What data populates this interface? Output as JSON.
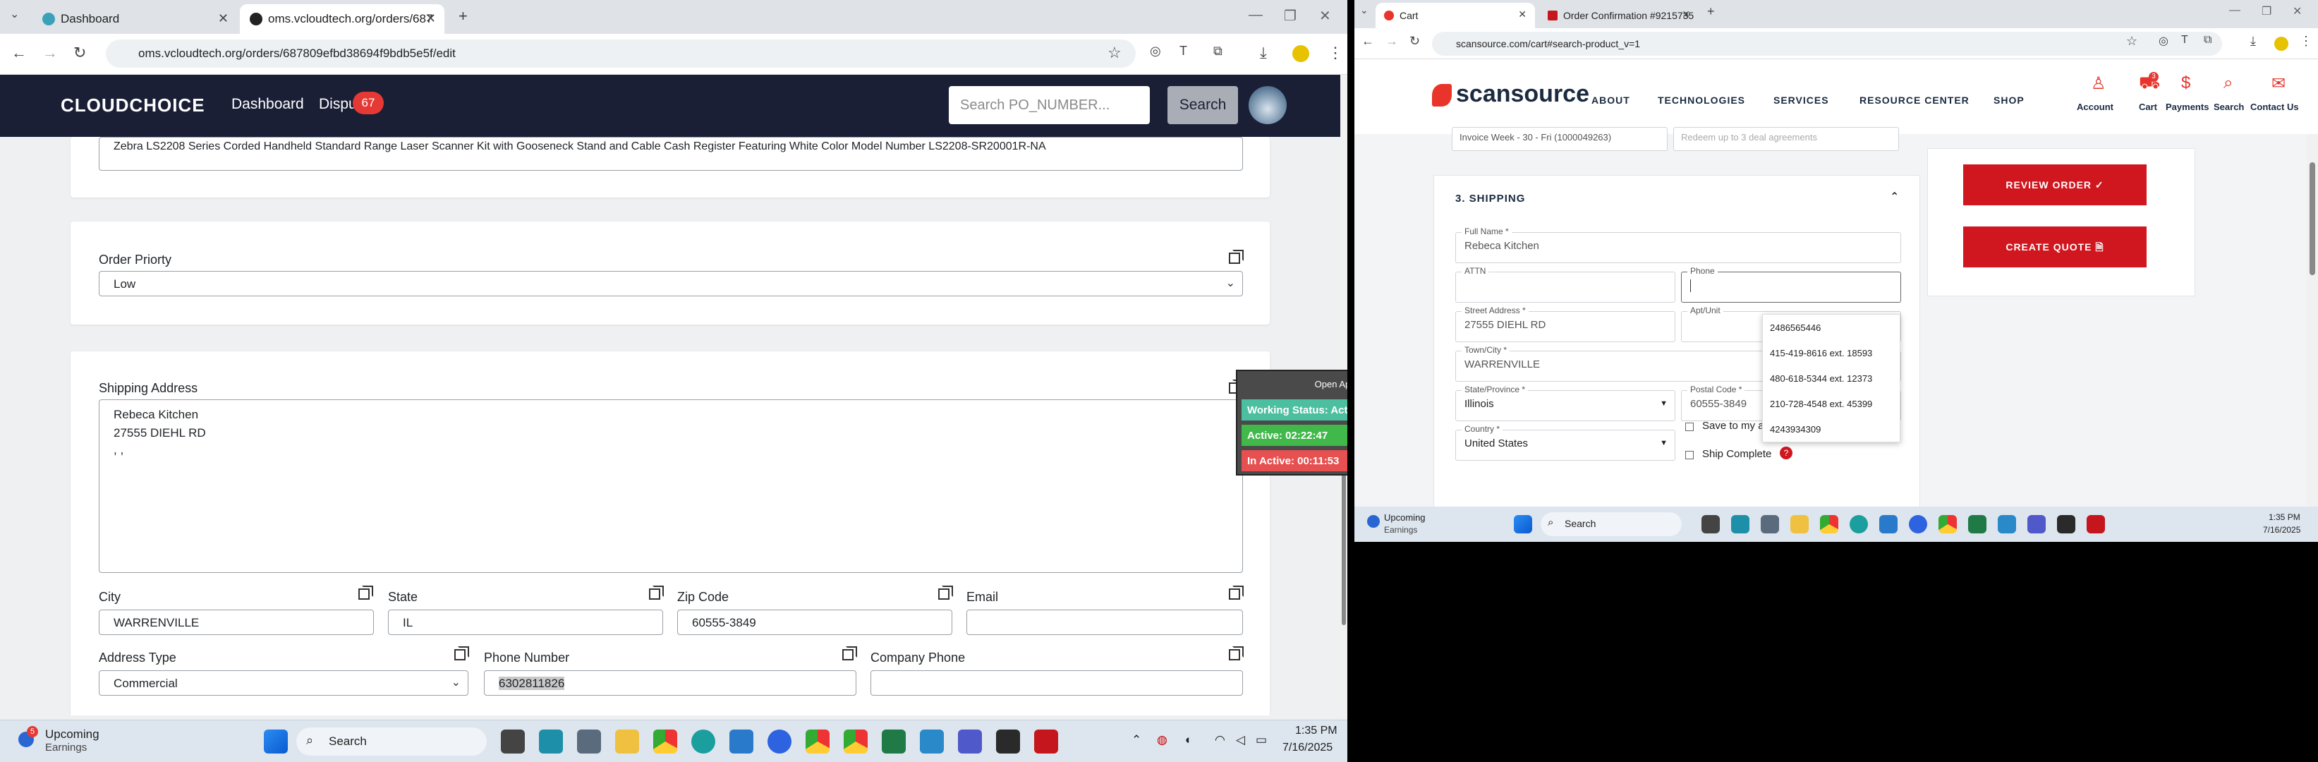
{
  "left_browser": {
    "tabs": [
      {
        "title": "Dashboard",
        "active": false
      },
      {
        "title": "oms.vcloudtech.org/orders/687",
        "active": true
      }
    ],
    "url": "oms.vcloudtech.org/orders/687809efbd38694f9bdb5e5f/edit",
    "app": {
      "logo": "CLOUDCHOICE",
      "nav": {
        "dashboard": "Dashboard",
        "disputes": "Dispu",
        "disputes_badge": "67"
      },
      "search_placeholder": "Search PO_NUMBER...",
      "search_button": "Search"
    },
    "form": {
      "product_description": "Zebra LS2208 Series Corded Handheld Standard Range Laser Scanner Kit with Gooseneck Stand and Cable Cash Register Featuring White Color Model Number LS2208-SR20001R-NA",
      "order_priority_label": "Order Priorty",
      "order_priority_value": "Low",
      "shipping_address_label": "Shipping Address",
      "shipping_address_lines": [
        "Rebeca Kitchen",
        "27555 DIEHL RD",
        ", ,"
      ],
      "city_label": "City",
      "city_value": "WARRENVILLE",
      "state_label": "State",
      "state_value": "IL",
      "zip_label": "Zip Code",
      "zip_value": "60555-3849",
      "email_label": "Email",
      "email_value": "",
      "address_type_label": "Address Type",
      "address_type_value": "Commercial",
      "phone_label": "Phone Number",
      "phone_value": "6302811826",
      "company_phone_label": "Company Phone",
      "company_phone_value": ""
    },
    "widget": {
      "open_app": "Open App ↗",
      "working_status": "Working Status: Active",
      "active": "Active: 02:22:47",
      "inactive": "In Active: 00:11:53"
    },
    "taskbar": {
      "weather_title": "Upcoming",
      "weather_sub": "Earnings",
      "weather_badge": "5",
      "search": "Search",
      "time": "1:35 PM",
      "date": "7/16/2025"
    }
  },
  "right_browser": {
    "tabs": [
      {
        "title": "Cart",
        "active": true
      },
      {
        "title": "Order Confirmation #9215735",
        "active": false
      }
    ],
    "url": "scansource.com/cart#search-product_v=1",
    "site": {
      "logo": "scansource",
      "menu": [
        "ABOUT",
        "TECHNOLOGIES",
        "SERVICES",
        "RESOURCE CENTER",
        "SHOP"
      ],
      "utils": [
        "Account",
        "Cart",
        "Payments",
        "Search",
        "Contact Us"
      ],
      "cart_count": "3"
    },
    "checkout": {
      "invoice_value": "Invoice Week - 30 - Fri (1000049263)",
      "deal_placeholder": "Redeem up to 3 deal agreements",
      "section_title": "3. SHIPPING",
      "full_name_label": "Full Name *",
      "full_name_value": "Rebeca Kitchen",
      "attn_label": "ATTN",
      "phone_label": "Phone",
      "street_label": "Street Address *",
      "street_value": "27555 DIEHL RD",
      "apt_label": "Apt/Unit",
      "town_label": "Town/City *",
      "town_value": "WARRENVILLE",
      "state_label": "State/Province *",
      "state_value": "Illinois",
      "postal_label": "Postal Code *",
      "postal_value": "60555-3849",
      "country_label": "Country *",
      "country_value": "United States",
      "save_address": "Save to my address book",
      "ship_complete": "Ship Complete",
      "phone_suggestions": [
        "2486565446",
        "415-419-8616 ext. 18593",
        "480-618-5344 ext. 12373",
        "210-728-4548 ext. 45399",
        "4243934309"
      ],
      "review_order": "REVIEW ORDER ✓",
      "create_quote": "CREATE QUOTE 🗎"
    },
    "taskbar": {
      "weather_title": "Upcoming",
      "weather_sub": "Earnings",
      "search": "Search",
      "time": "1:35 PM",
      "date": "7/16/2025"
    }
  }
}
